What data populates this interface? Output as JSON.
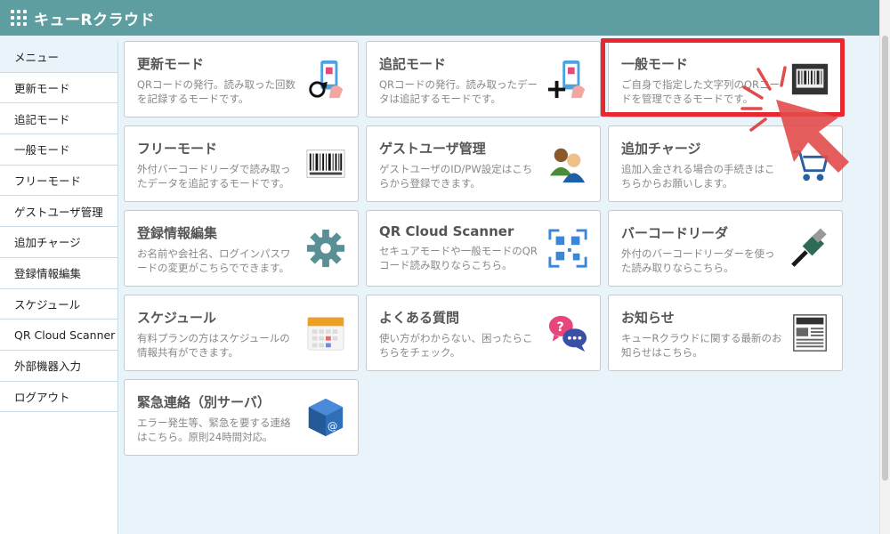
{
  "app": {
    "title": "キューRクラウド"
  },
  "sidebar": {
    "items": [
      {
        "label": "メニュー"
      },
      {
        "label": "更新モード"
      },
      {
        "label": "追記モード"
      },
      {
        "label": "一般モード"
      },
      {
        "label": "フリーモード"
      },
      {
        "label": "ゲストユーザ管理"
      },
      {
        "label": "追加チャージ"
      },
      {
        "label": "登録情報編集"
      },
      {
        "label": "スケジュール"
      },
      {
        "label": "QR Cloud Scanner"
      },
      {
        "label": "外部機器入力"
      },
      {
        "label": "ログアウト"
      }
    ]
  },
  "cards": [
    {
      "title": "更新モード",
      "desc": "QRコードの発行。読み取った回数を記録するモードです。",
      "icon": "qr-update-icon"
    },
    {
      "title": "追記モード",
      "desc": "QRコードの発行。読み取ったデータは追記するモードです。",
      "icon": "qr-append-icon"
    },
    {
      "title": "一般モード",
      "desc": "ご自身で指定した文字列のQRコードを管理できるモードです。",
      "icon": "barcode-scan-icon"
    },
    {
      "title": "フリーモード",
      "desc": "外付バーコードリーダで読み取ったデータを追記するモードです。",
      "icon": "barcode-icon"
    },
    {
      "title": "ゲストユーザ管理",
      "desc": "ゲストユーザのID/PW設定はこちらから登録できます。",
      "icon": "users-icon"
    },
    {
      "title": "追加チャージ",
      "desc": "追加入金される場合の手続きはこちらからお願いします。",
      "icon": "cart-icon"
    },
    {
      "title": "登録情報編集",
      "desc": "お名前や会社名、ログインパスワードの変更がこちらでできます。",
      "icon": "gear-icon"
    },
    {
      "title": "QR Cloud Scanner",
      "desc": "セキュアモードや一般モードのQRコード読み取りならこちら。",
      "icon": "qr-scanner-icon"
    },
    {
      "title": "バーコードリーダ",
      "desc": "外付のバーコードリーダーを使った読み取りならこちら。",
      "icon": "usb-icon"
    },
    {
      "title": "スケジュール",
      "desc": "有料プランの方はスケジュールの情報共有ができます。",
      "icon": "calendar-icon"
    },
    {
      "title": "よくある質問",
      "desc": "使い方がわからない、困ったらこちらをチェック。",
      "icon": "faq-chat-icon"
    },
    {
      "title": "お知らせ",
      "desc": "キューRクラウドに関する最新のお知らせはこちら。",
      "icon": "news-icon"
    },
    {
      "title": "緊急連絡（別サーバ）",
      "desc": "エラー発生等、緊急を要する連絡はこちら。原則24時間対応。",
      "icon": "contact-cube-icon"
    }
  ]
}
